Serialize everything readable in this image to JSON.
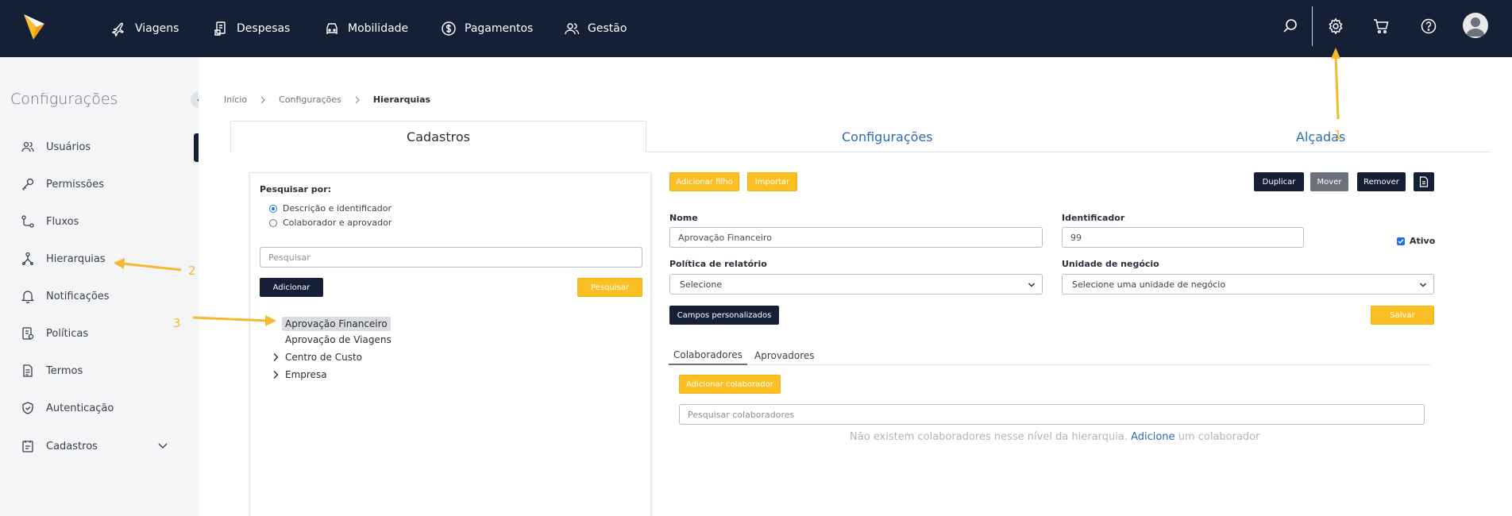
{
  "topbar": {
    "nav": [
      {
        "label": "Viagens",
        "icon": "plane-icon"
      },
      {
        "label": "Despesas",
        "icon": "receipt-icon"
      },
      {
        "label": "Mobilidade",
        "icon": "car-icon"
      },
      {
        "label": "Pagamentos",
        "icon": "dollar-icon"
      },
      {
        "label": "Gestão",
        "icon": "users-icon"
      }
    ],
    "icons": [
      "search-icon",
      "gear-icon",
      "cart-icon",
      "help-icon",
      "avatar"
    ]
  },
  "sidebar": {
    "title": "Configurações",
    "items": [
      {
        "label": "Usuários",
        "icon": "users-icon"
      },
      {
        "label": "Permissões",
        "icon": "key-icon"
      },
      {
        "label": "Fluxos",
        "icon": "flow-icon"
      },
      {
        "label": "Hierarquias",
        "icon": "hierarchy-icon"
      },
      {
        "label": "Notificações",
        "icon": "bell-icon"
      },
      {
        "label": "Políticas",
        "icon": "policy-icon"
      },
      {
        "label": "Termos",
        "icon": "document-icon"
      },
      {
        "label": "Autenticação",
        "icon": "shield-icon"
      },
      {
        "label": "Cadastros",
        "icon": "register-icon"
      }
    ]
  },
  "breadcrumb": [
    "Início",
    "Configurações",
    "Hierarquias"
  ],
  "tabs": [
    "Cadastros",
    "Configurações",
    "Alçadas"
  ],
  "search_panel": {
    "title": "Pesquisar por:",
    "options": [
      "Descrição e identificador",
      "Colaborador e aprovador"
    ],
    "search_placeholder": "Pesquisar",
    "add_label": "Adicionar",
    "search_label": "Pesquisar",
    "tree": [
      {
        "label": "Aprovação Financeiro",
        "selected": true
      },
      {
        "label": "Aprovação de Viagens"
      },
      {
        "label": "Centro de Custo",
        "expandable": true
      },
      {
        "label": "Empresa",
        "expandable": true
      }
    ]
  },
  "form": {
    "add_child_label": "Adicionar filho",
    "import_label": "Importar",
    "duplicate_label": "Duplicar",
    "move_label": "Mover",
    "remove_label": "Remover",
    "name_label": "Nome",
    "name_value": "Aprovação Financeiro",
    "id_label": "Identificador",
    "id_value": "99",
    "active_label": "Ativo",
    "policy_label": "Política de relatório",
    "policy_value": "Selecione",
    "unit_label": "Unidade de negócio",
    "unit_value": "Selecione uma unidade de negócio",
    "custom_fields_label": "Campos personalizados",
    "save_label": "Salvar",
    "subtabs": [
      "Colaboradores",
      "Aprovadores"
    ],
    "add_collab_label": "Adicionar colaborador",
    "collab_search_placeholder": "Pesquisar colaboradores",
    "empty_prefix": "Não existem colaboradores nesse nível da hierarquia.",
    "empty_link": "Adicione",
    "empty_suffix": "um colaborador"
  },
  "annotations": [
    "1",
    "2",
    "3"
  ],
  "colors": {
    "navy": "#152037",
    "yellow": "#fbbf24",
    "link": "#2d6cb0"
  }
}
